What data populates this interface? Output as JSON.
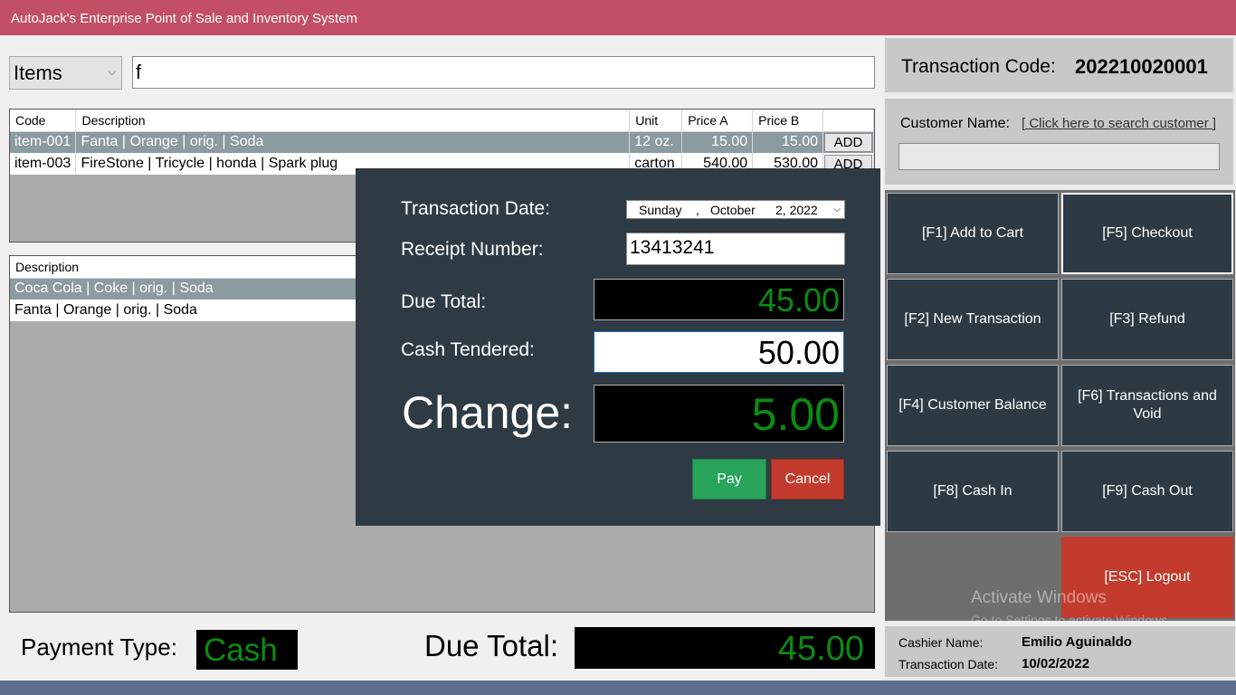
{
  "window": {
    "title": "AutoJack's Enterprise Point of Sale and Inventory System"
  },
  "search": {
    "type_selected": "Items",
    "query": "f"
  },
  "items_table": {
    "headers": [
      "Code",
      "Description",
      "Unit",
      "Price A",
      "Price B",
      ""
    ],
    "rows": [
      {
        "code": "item-001",
        "description": "Fanta | Orange | orig. | Soda",
        "unit": "12 oz.",
        "price_a": "15.00",
        "price_b": "15.00",
        "action": "ADD"
      },
      {
        "code": "item-003",
        "description": "FireStone | Tricycle | honda | Spark plug",
        "unit": "carton",
        "price_a": "540.00",
        "price_b": "530.00",
        "action": "ADD"
      }
    ]
  },
  "cart_table": {
    "headers": [
      "Description"
    ],
    "rows": [
      {
        "description": "Coca Cola | Coke | orig. | Soda"
      },
      {
        "description": "Fanta | Orange | orig. | Soda"
      }
    ]
  },
  "footer": {
    "payment_type_label": "Payment Type:",
    "payment_type_value": "Cash",
    "due_total_label": "Due Total:",
    "due_total_value": "45.00"
  },
  "right_panel": {
    "transaction_code_label": "Transaction Code:",
    "transaction_code_value": "202210020001",
    "customer_name_label": "Customer Name:",
    "customer_search_link": "[ Click here to search customer ]",
    "customer_name_value": "",
    "buttons": [
      {
        "label": "[F1] Add to Cart"
      },
      {
        "label": "[F5] Checkout"
      },
      {
        "label": "[F2] New Transaction"
      },
      {
        "label": "[F3] Refund"
      },
      {
        "label": "[F4] Customer Balance"
      },
      {
        "label": "[F6] Transactions and Void"
      },
      {
        "label": "[F8] Cash In"
      },
      {
        "label": "[F9] Cash Out"
      },
      {
        "label": "[ESC] Logout"
      }
    ],
    "cashier_name_label": "Cashier Name:",
    "cashier_name_value": "Emilio Aguinaldo",
    "transaction_date_label": "Transaction Date:",
    "transaction_date_value": "10/02/2022"
  },
  "watermark": {
    "line1": "Activate Windows",
    "line2": "Go to Settings to activate Windows."
  },
  "checkout_dialog": {
    "transaction_date_label": "Transaction Date:",
    "date_weekday": "Sunday",
    "date_sep": ",",
    "date_month": "October",
    "date_day_year": "2, 2022",
    "receipt_number_label": "Receipt Number:",
    "receipt_number_value": "13413241",
    "due_total_label": "Due Total:",
    "due_total_value": "45.00",
    "cash_tendered_label": "Cash Tendered:",
    "cash_tendered_value": "50.00",
    "change_label": "Change:",
    "change_value": "5.00",
    "pay_label": "Pay",
    "cancel_label": "Cancel"
  },
  "colors": {
    "titlebar": "#c24f66",
    "panel_dark": "#2e3b44",
    "amount_green": "#0c8b12",
    "pay_green": "#27a35a",
    "cancel_red": "#c23b2d"
  }
}
